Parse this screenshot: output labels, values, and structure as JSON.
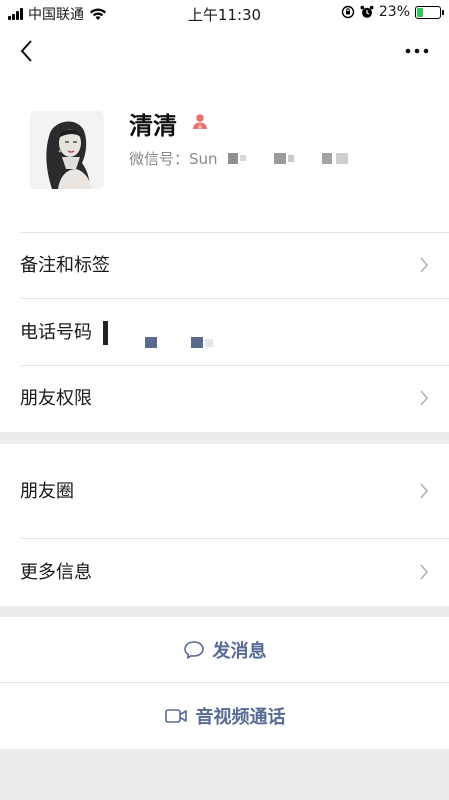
{
  "status_bar": {
    "carrier": "中国联通",
    "time": "上午11:30",
    "battery": "23%",
    "battery_level": 0.23
  },
  "profile": {
    "name": "清清",
    "wechat_id_label": "微信号：",
    "wechat_id_visible": "Sun"
  },
  "menu": {
    "remark_tags": "备注和标签",
    "phone": "电话号码",
    "friend_permissions": "朋友权限",
    "moments": "朋友圈",
    "more_info": "更多信息"
  },
  "actions": {
    "send_message": "发消息",
    "video_call": "音视频通话"
  },
  "colors": {
    "accent": "#576b95",
    "gender_female": "#e97270",
    "battery_fill": "#34c759"
  }
}
